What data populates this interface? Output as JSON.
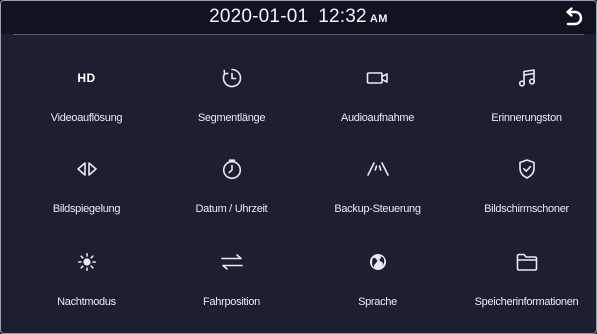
{
  "header": {
    "date": "2020-01-01",
    "time": "12:32",
    "ampm": "AM"
  },
  "back_icon": "return-arrow-icon",
  "menu": {
    "items": [
      {
        "label": "Videoauflösung",
        "icon": "hd-icon",
        "icon_text": "HD"
      },
      {
        "label": "Segmentlänge",
        "icon": "timer-icon"
      },
      {
        "label": "Audioaufnahme",
        "icon": "video-camera-icon"
      },
      {
        "label": "Erinnerungston",
        "icon": "music-note-icon"
      },
      {
        "label": "Bildspiegelung",
        "icon": "mirror-icon"
      },
      {
        "label": "Datum / Uhrzeit",
        "icon": "clock-icon"
      },
      {
        "label": "Backup-Steuerung",
        "icon": "parking-lines-icon"
      },
      {
        "label": "Bildschirmschoner",
        "icon": "shield-check-icon"
      },
      {
        "label": "Nachtmodus",
        "icon": "sun-icon"
      },
      {
        "label": "Fahrposition",
        "icon": "swap-arrows-icon"
      },
      {
        "label": "Sprache",
        "icon": "globe-icon"
      },
      {
        "label": "Speicherinformationen",
        "icon": "folder-icon"
      }
    ]
  }
}
